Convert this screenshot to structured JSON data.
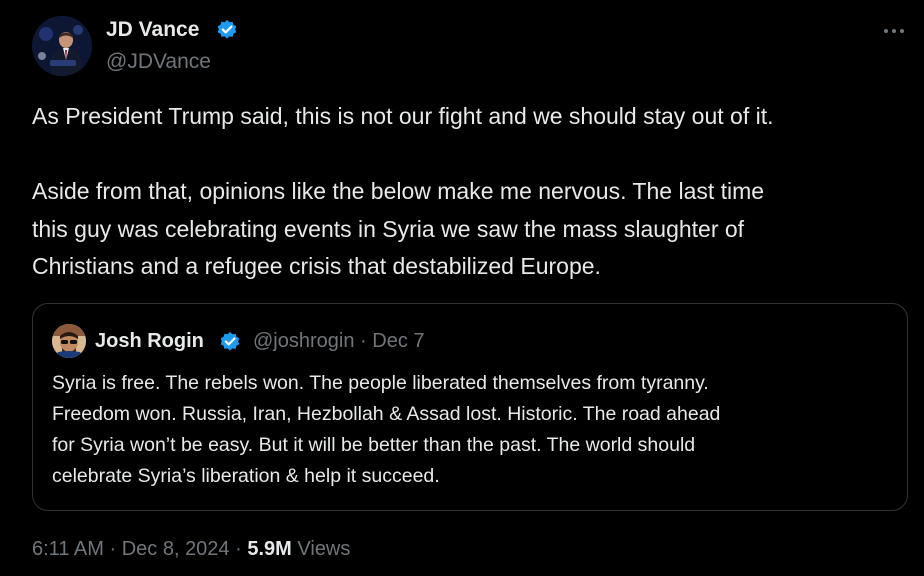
{
  "author": {
    "name": "JD Vance",
    "handle": "@JDVance",
    "verified_color": "#1d9bf0"
  },
  "tweet": {
    "paragraph1": "As President Trump said, this is not our fight and we should stay out of it.",
    "paragraph2_line1": "Aside from that, opinions like the below make me nervous. The last time",
    "paragraph2_line2": "this guy was celebrating events in Syria we saw the mass slaughter of",
    "paragraph2_line3": "Christians and a refugee crisis that destabilized Europe."
  },
  "quote": {
    "name": "Josh Rogin",
    "handle": "@joshrogin",
    "separator": "·",
    "date": "Dec 7",
    "line1": "Syria is free. The rebels won. The people liberated themselves from tyranny.",
    "line2": "Freedom won. Russia, Iran, Hezbollah & Assad lost. Historic. The road ahead",
    "line3": "for Syria won’t be easy. But it will be better than the past. The world should",
    "line4": "celebrate Syria’s liberation & help it succeed."
  },
  "footer": {
    "time": "6:11 AM",
    "separator1": "·",
    "date": "Dec 8, 2024",
    "separator2": "·",
    "views_count": "5.9M",
    "views_label": "Views"
  },
  "icons": {
    "more": "more-dots-icon",
    "verified": "verified-badge-icon"
  },
  "colors": {
    "background": "#000000",
    "text_primary": "#e7e9ea",
    "text_secondary": "#71767b",
    "border": "#2f3336",
    "accent": "#1d9bf0"
  }
}
